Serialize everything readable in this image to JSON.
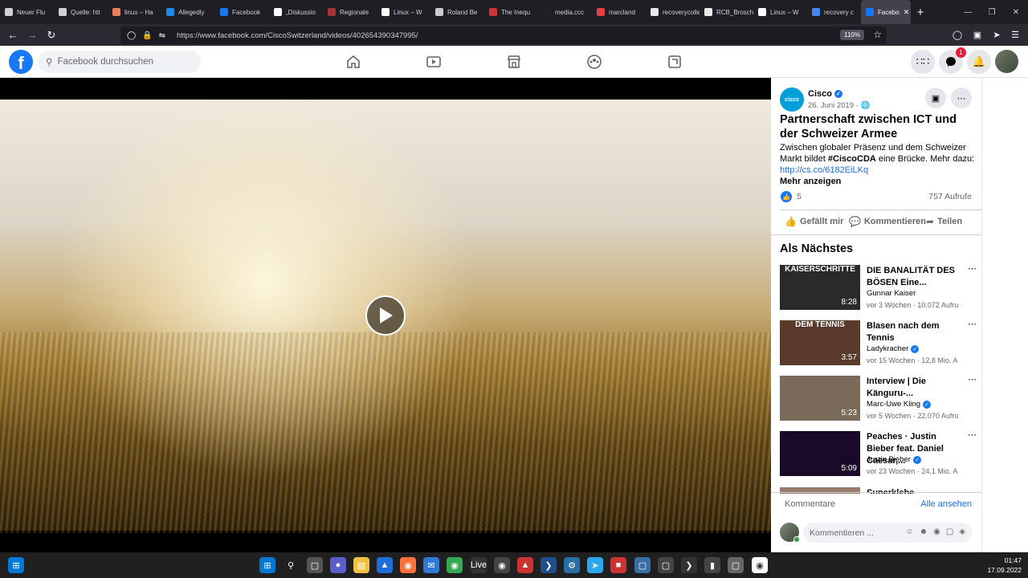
{
  "browser": {
    "tabs": [
      {
        "label": "Neuer Flu",
        "color": "#cfcfd8"
      },
      {
        "label": "Quelle: htt",
        "color": "#cfcfd8"
      },
      {
        "label": "linux – Ha",
        "color": "#e8805a"
      },
      {
        "label": "Allegedly",
        "color": "#1e88e5"
      },
      {
        "label": "Facebook",
        "color": "#1877f2"
      },
      {
        "label": "„Diskussio",
        "color": "#ffffff"
      },
      {
        "label": "Regionale",
        "color": "#a33"
      },
      {
        "label": "Linux – W",
        "color": "#ffffff"
      },
      {
        "label": "Roland Be",
        "color": "#ccc"
      },
      {
        "label": "The Inequ",
        "color": "#c33"
      },
      {
        "label": "media.ccc",
        "color": "#222"
      },
      {
        "label": "marcland",
        "color": "#e04040"
      },
      {
        "label": "recoverycolleg",
        "color": "#e8e8e8"
      },
      {
        "label": "RCB_Broschur",
        "color": "#e8e8e8"
      },
      {
        "label": "Linux – W",
        "color": "#ffffff"
      },
      {
        "label": "recovery c",
        "color": "#4285f4"
      }
    ],
    "active_tab": {
      "label": "Facebo",
      "close": "✕"
    },
    "new_tab": "+",
    "url": "https://www.facebook.com/CiscoSwitzerland/videos/402654390347995/",
    "zoom": "110%",
    "notif_badge": ""
  },
  "fb": {
    "search_placeholder": "Facebook durchsuchen",
    "messenger_badge": "1"
  },
  "post": {
    "page_name": "Cisco",
    "date": "26. Juni 2019 ·",
    "title": "Partnerschaft zwischen ICT und der Schweizer Armee",
    "text_before": "Zwischen globaler Präsenz und dem Schweizer Markt bildet ",
    "hashtag": "#CiscoCDA",
    "text_after": " eine Brücke. Mehr dazu:",
    "link": "http://cs.co/6182EiLKq",
    "more": "Mehr anzeigen",
    "likes": "5",
    "views": "757 Aufrufe",
    "like_label": "Gefällt mir",
    "comment_label": "Kommentieren",
    "share_label": "Teilen"
  },
  "next": {
    "title": "Als Nächstes",
    "items": [
      {
        "title": "DIE BANALITÄT DES BÖSEN Eine...",
        "channel": "Gunnar Kaiser",
        "verified": false,
        "meta": "vor 3 Wochen · 10.072 Aufru",
        "duration": "8:28",
        "thumb_label": "KAISERSCHRITTE",
        "thumb_color": "#2a2a2a"
      },
      {
        "title": "Blasen nach dem Tennis",
        "channel": "Ladykracher",
        "verified": true,
        "meta": "vor 15 Wochen · 12,8 Mio. A",
        "duration": "3:57",
        "thumb_label": "DEM TENNIS",
        "thumb_color": "#5a3a2a"
      },
      {
        "title": "Interview | Die Känguru-...",
        "channel": "Marc-Uwe Kling",
        "verified": true,
        "meta": "vor 5 Wochen · 22.070 Aufru",
        "duration": "5:23",
        "thumb_label": "",
        "thumb_color": "#7a6a5a"
      },
      {
        "title": "Peaches · Justin Bieber feat. Daniel Caesar,...",
        "channel": "Justin Bieber",
        "verified": true,
        "meta": "vor 23 Wochen · 24,1 Mio. A",
        "duration": "5:09",
        "thumb_label": "",
        "thumb_color": "#1a0a2a"
      }
    ],
    "partial_title": "Superklebe..."
  },
  "comments": {
    "header": "Kommentare",
    "see_all": "Alle ansehen",
    "placeholder": "Kommentieren ..."
  },
  "taskbar": {
    "time": "01:47",
    "date": "17.09.2022"
  }
}
